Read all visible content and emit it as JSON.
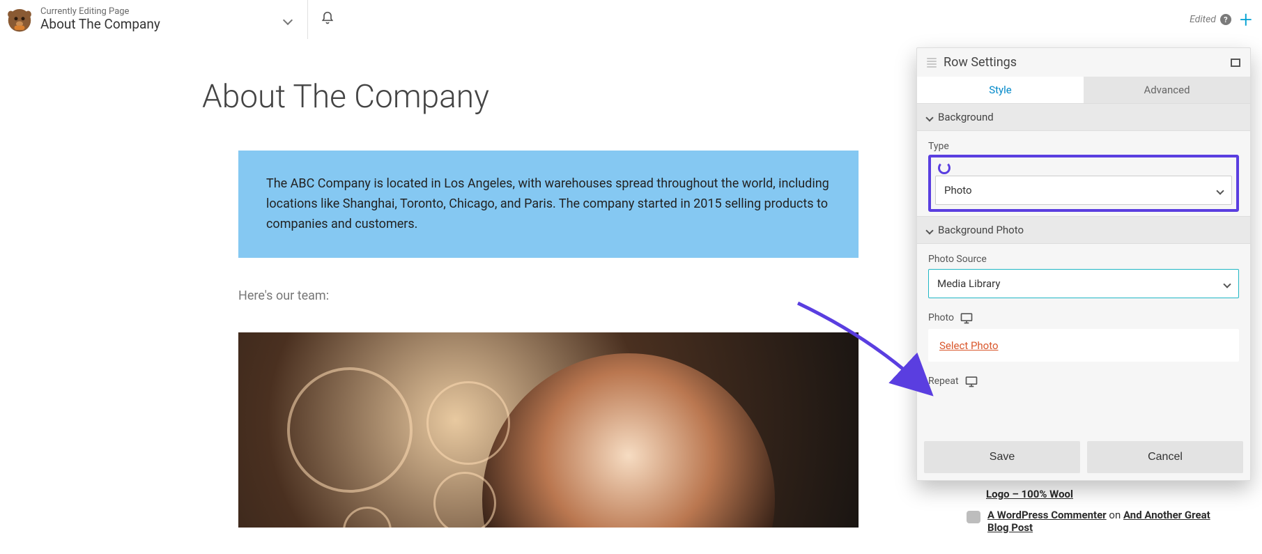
{
  "topbar": {
    "subtitle": "Currently Editing Page",
    "title": "About The Company",
    "edited_label": "Edited"
  },
  "page": {
    "heading": "About The Company",
    "intro": "The ABC Company is located in Los Angeles, with warehouses spread throughout the world, including locations like Shanghai, Toronto, Chicago, and Paris. The company started in 2015 selling products to companies and customers.",
    "team_line": "Here's our team:"
  },
  "panel": {
    "title": "Row Settings",
    "tabs": {
      "style": "Style",
      "advanced": "Advanced"
    },
    "sections": {
      "background": {
        "title": "Background",
        "type_label": "Type",
        "type_value": "Photo"
      },
      "background_photo": {
        "title": "Background Photo",
        "source_label": "Photo Source",
        "source_value": "Media Library",
        "photo_label": "Photo",
        "select_photo": "Select Photo",
        "repeat_label": "Repeat"
      }
    },
    "buttons": {
      "save": "Save",
      "cancel": "Cancel"
    }
  },
  "bg_comments": {
    "item1_link": "Logo – 100% Wool",
    "item2_author": "A WordPress Commenter",
    "item2_on": " on ",
    "item2_link": "And Another Great Blog Post"
  }
}
